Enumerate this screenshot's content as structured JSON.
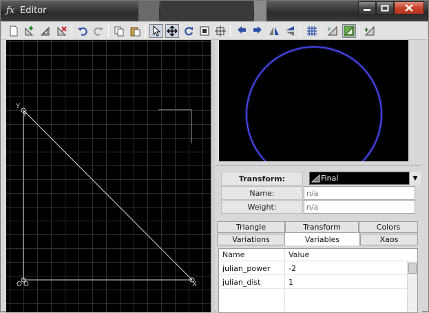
{
  "window": {
    "title": "Editor",
    "icon": "fx-logo-icon"
  },
  "toolbar": {
    "buttons": [
      "new-transform-icon",
      "add-transform-icon",
      "duplicate-transform-icon",
      "delete-transform-icon",
      "undo-icon",
      "redo-icon",
      "copy-icon",
      "paste-icon",
      "select-mode-icon",
      "move-mode-icon",
      "rotate-mode-icon",
      "scale-mode-icon",
      "pivot-mode-icon",
      "rotate-left-icon",
      "rotate-right-icon",
      "flip-horizontal-icon",
      "flip-vertical-icon",
      "grid-icon",
      "post-transform-icon",
      "final-transform-icon",
      "reset-icon"
    ]
  },
  "canvas": {
    "vertex_labels": {
      "y_outer": "Y",
      "y_inner": "Y",
      "o_outer": "O",
      "o_inner": "O",
      "x_inner": "X"
    }
  },
  "transform": {
    "label": "Transform:",
    "selected": "Final",
    "name_label": "Name:",
    "name_value": "n/a",
    "weight_label": "Weight:",
    "weight_value": "n/a"
  },
  "tabs": {
    "row1": [
      "Triangle",
      "Transform",
      "Colors"
    ],
    "row2": [
      "Variations",
      "Variables",
      "Xaos"
    ],
    "active": "Variables"
  },
  "variables": {
    "headers": {
      "name": "Name",
      "value": "Value"
    },
    "rows": [
      {
        "name": "julian_power",
        "value": "-2"
      },
      {
        "name": "julian_dist",
        "value": "1"
      }
    ]
  },
  "colors": {
    "preview_ring": "#4b4bff",
    "canvas_bg": "#000000"
  }
}
